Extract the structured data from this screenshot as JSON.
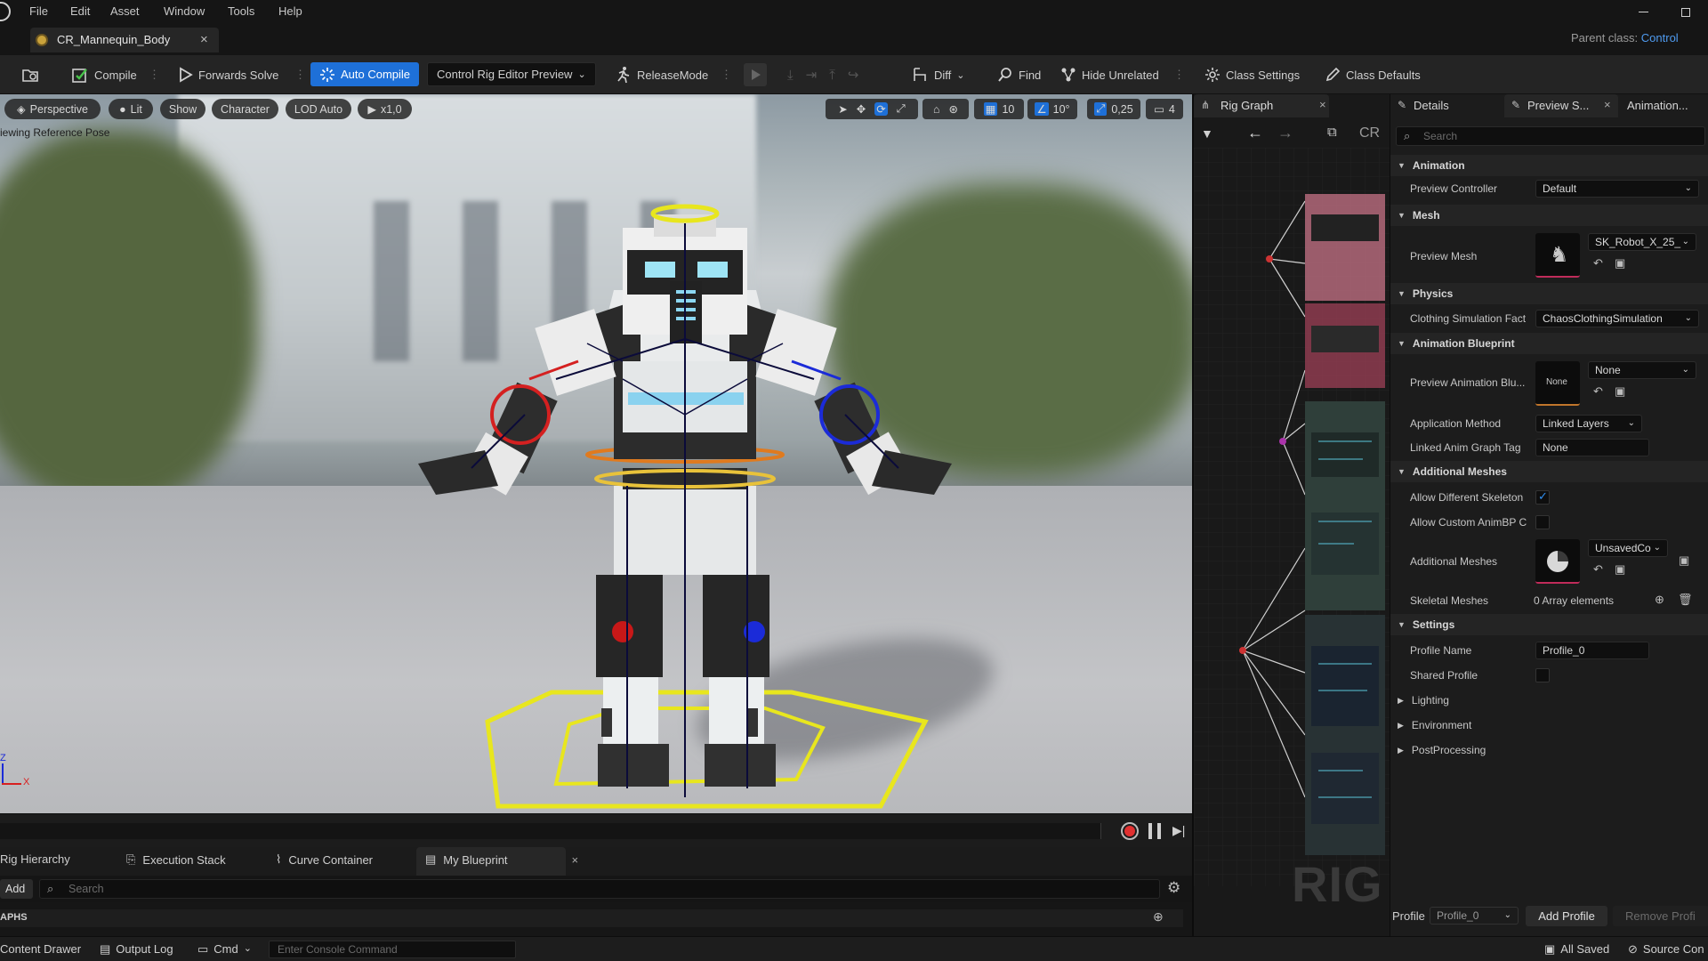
{
  "menu": [
    "File",
    "Edit",
    "Asset",
    "Window",
    "Tools",
    "Help"
  ],
  "tab": {
    "title": "CR_Mannequin_Body",
    "close": "×"
  },
  "parent_class": {
    "label": "Parent class:",
    "value": "Control"
  },
  "toolbar": {
    "compile": "Compile",
    "forwards_solve": "Forwards Solve",
    "auto_compile": "Auto Compile",
    "preview_mode": "Control Rig Editor Preview",
    "release_mode": "ReleaseMode",
    "diff": "Diff",
    "find": "Find",
    "hide_unrelated": "Hide Unrelated",
    "class_settings": "Class Settings",
    "class_defaults": "Class Defaults"
  },
  "viewport": {
    "perspective": "Perspective",
    "lit": "Lit",
    "show": "Show",
    "character": "Character",
    "lod": "LOD Auto",
    "speed": "x1,0",
    "overlay_text": "iewing Reference Pose",
    "grid_snap": "10",
    "rot_snap": "10°",
    "scale_snap": "0,25",
    "camera_speed": "4",
    "axis_z": "Z",
    "axis_x": "X"
  },
  "rig_graph": {
    "tab": "Rig Graph",
    "watermark": "RIG",
    "cr_label": "CR"
  },
  "bottom_tabs": [
    "Rig Hierarchy",
    "Execution Stack",
    "Curve Container",
    "My Blueprint"
  ],
  "blueprint": {
    "add": "Add",
    "search_placeholder": "Search",
    "graphs_label": "APHS"
  },
  "details": {
    "tabs": [
      "Details",
      "Preview S...",
      "Animation..."
    ],
    "search_placeholder": "Search",
    "animation": {
      "header": "Animation",
      "preview_controller_label": "Preview Controller",
      "preview_controller_value": "Default"
    },
    "mesh": {
      "header": "Mesh",
      "preview_mesh_label": "Preview Mesh",
      "preview_mesh_value": "SK_Robot_X_25_"
    },
    "physics": {
      "header": "Physics",
      "clothing_label": "Clothing Simulation Fact",
      "clothing_value": "ChaosClothingSimulation"
    },
    "anim_bp": {
      "header": "Animation Blueprint",
      "preview_anim_label": "Preview Animation Blu...",
      "preview_anim_thumb": "None",
      "preview_anim_value": "None",
      "app_method_label": "Application Method",
      "app_method_value": "Linked Layers",
      "linked_tag_label": "Linked Anim Graph Tag",
      "linked_tag_value": "None"
    },
    "additional": {
      "header": "Additional Meshes",
      "allow_diff_label": "Allow Different Skeleton",
      "allow_diff_checked": true,
      "allow_custom_label": "Allow Custom AnimBP C",
      "allow_custom_checked": false,
      "meshes_label": "Additional Meshes",
      "meshes_value": "UnsavedCo",
      "skeletal_label": "Skeletal Meshes",
      "skeletal_value": "0 Array elements"
    },
    "settings": {
      "header": "Settings",
      "profile_name_label": "Profile Name",
      "profile_name_value": "Profile_0",
      "shared_label": "Shared Profile",
      "shared_checked": false,
      "lighting": "Lighting",
      "environment": "Environment",
      "postprocessing": "PostProcessing"
    },
    "profile_bar": {
      "label": "Profile",
      "value": "Profile_0",
      "add": "Add Profile",
      "remove": "Remove Profi"
    }
  },
  "status": {
    "content_drawer": "Content Drawer",
    "output_log": "Output Log",
    "cmd": "Cmd",
    "console_placeholder": "Enter Console Command",
    "all_saved": "All Saved",
    "source_control": "Source Con"
  },
  "colors": {
    "accent": "#1e70d8",
    "selection_yellow": "#e8e61e",
    "left_red": "#d82020",
    "right_blue": "#1b2bd8"
  }
}
